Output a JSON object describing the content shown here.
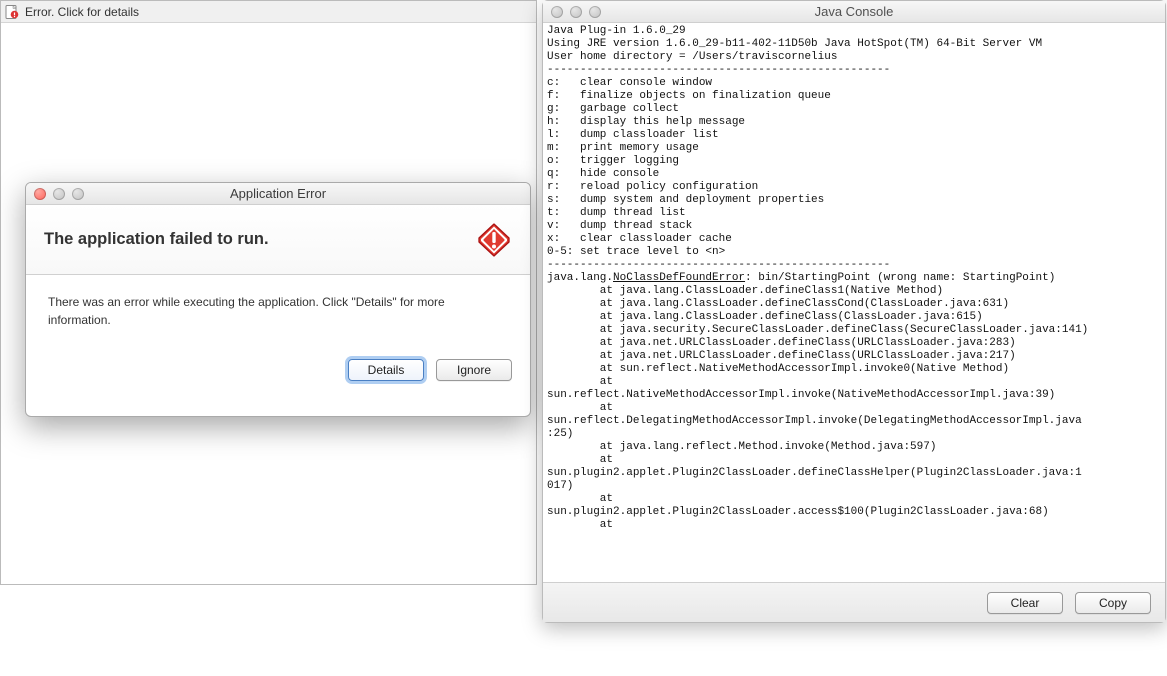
{
  "left_panel": {
    "applet_bar_text": "Error.  Click for details"
  },
  "error_dialog": {
    "title": "Application Error",
    "heading": "The application failed to run.",
    "body": "There was an error while executing the application.  Click \"Details\" for more information.",
    "details_button": "Details",
    "ignore_button": "Ignore"
  },
  "console": {
    "title": "Java Console",
    "lines": [
      "Java Plug-in 1.6.0_29",
      "Using JRE version 1.6.0_29-b11-402-11D50b Java HotSpot(TM) 64-Bit Server VM",
      "User home directory = /Users/traviscornelius",
      "----------------------------------------------------",
      "c:   clear console window",
      "f:   finalize objects on finalization queue",
      "g:   garbage collect",
      "h:   display this help message",
      "l:   dump classloader list",
      "m:   print memory usage",
      "o:   trigger logging",
      "q:   hide console",
      "r:   reload policy configuration",
      "s:   dump system and deployment properties",
      "t:   dump thread list",
      "v:   dump thread stack",
      "x:   clear classloader cache",
      "0-5: set trace level to <n>",
      "----------------------------------------------------",
      "",
      ""
    ],
    "error_token": "NoClassDefFoundError",
    "error_prefix": "java.lang.",
    "error_suffix": ": bin/StartingPoint (wrong name: StartingPoint)",
    "stack": [
      "        at java.lang.ClassLoader.defineClass1(Native Method)",
      "        at java.lang.ClassLoader.defineClassCond(ClassLoader.java:631)",
      "        at java.lang.ClassLoader.defineClass(ClassLoader.java:615)",
      "        at java.security.SecureClassLoader.defineClass(SecureClassLoader.java:141)",
      "        at java.net.URLClassLoader.defineClass(URLClassLoader.java:283)",
      "        at java.net.URLClassLoader.defineClass(URLClassLoader.java:217)",
      "        at sun.reflect.NativeMethodAccessorImpl.invoke0(Native Method)",
      "        at",
      "sun.reflect.NativeMethodAccessorImpl.invoke(NativeMethodAccessorImpl.java:39)",
      "        at",
      "sun.reflect.DelegatingMethodAccessorImpl.invoke(DelegatingMethodAccessorImpl.java",
      ":25)",
      "        at java.lang.reflect.Method.invoke(Method.java:597)",
      "        at",
      "sun.plugin2.applet.Plugin2ClassLoader.defineClassHelper(Plugin2ClassLoader.java:1",
      "017)",
      "        at",
      "sun.plugin2.applet.Plugin2ClassLoader.access$100(Plugin2ClassLoader.java:68)",
      "        at"
    ],
    "clear_button": "Clear",
    "copy_button": "Copy"
  }
}
